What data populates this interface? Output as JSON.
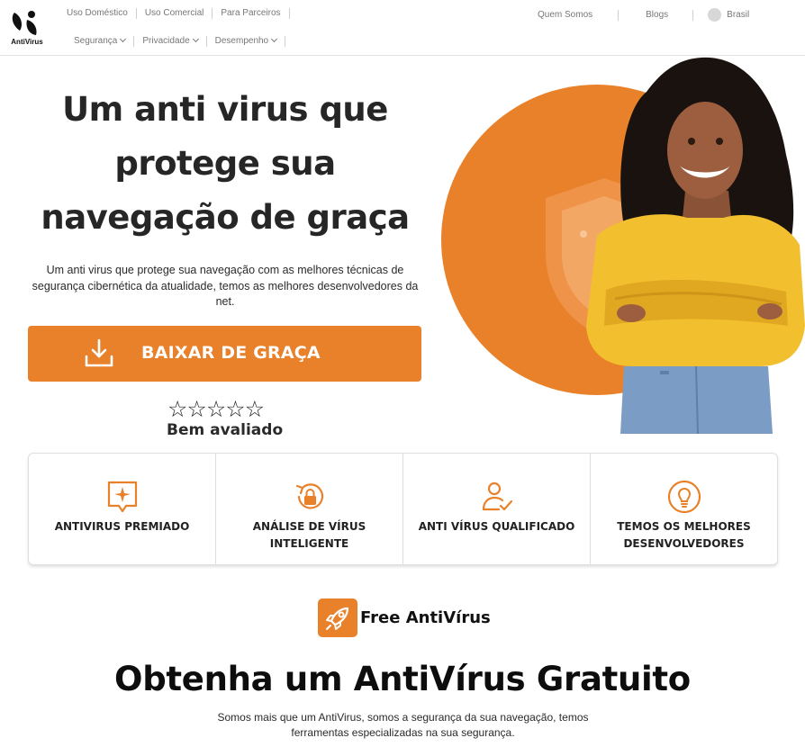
{
  "brand": {
    "logo_text": "AntiVirus",
    "accent": "#e8812a"
  },
  "nav": {
    "top": [
      "Uso Doméstico",
      "Uso Comercial",
      "Para Parceiros"
    ],
    "bottom": [
      "Segurança",
      "Privacidade",
      "Desempenho"
    ],
    "right": {
      "about": "Quem Somos",
      "blogs": "Blogs",
      "language": "Brasil"
    }
  },
  "hero": {
    "title": "Um anti virus que protege sua navegação de graça",
    "description": "Um anti virus que protege sua navegação com as melhores técnicas de segurança cibernética da atualidade, temos as melhores desenvolvedores da net.",
    "cta_label": "BAIXAR DE GRAÇA",
    "stars": "☆☆☆☆☆",
    "rating_label": "Bem avaliado"
  },
  "features": [
    {
      "label": "ANTIVIRUS PREMIADO",
      "icon": "award-message-icon"
    },
    {
      "label": "ANÁLISE DE VÍRUS INTELIGENTE",
      "icon": "lock-refresh-icon"
    },
    {
      "label": "ANTI VÍRUS QUALIFICADO",
      "icon": "user-check-icon"
    },
    {
      "label": "TEMOS OS MELHORES DESENVOLVEDORES",
      "icon": "lightbulb-icon"
    }
  ],
  "section": {
    "badge_label": "Free AntiVírus",
    "title": "Obtenha um AntiVírus Gratuito",
    "description": "Somos mais que um AntiVirus, somos a segurança da sua navegação, temos ferramentas especializadas na sua segurança."
  }
}
